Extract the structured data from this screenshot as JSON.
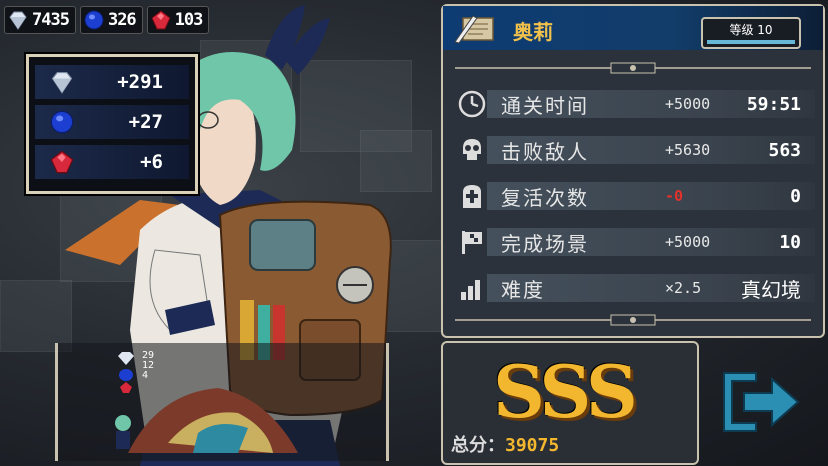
{
  "currency": {
    "diamond": {
      "icon": "diamond-icon",
      "value": "7435"
    },
    "sapphire": {
      "icon": "sapphire-icon",
      "value": "326"
    },
    "ruby": {
      "icon": "ruby-icon",
      "value": "103"
    }
  },
  "rewards": {
    "diamond": "+291",
    "sapphire": "+27",
    "ruby": "+6"
  },
  "character": {
    "name": "奥莉",
    "level_label": "等级 10",
    "level_progress": 1.0
  },
  "stats": [
    {
      "icon": "clock-icon",
      "label": "通关时间",
      "bonus": "+5000",
      "value": "59:51",
      "bonus_color": "#e8e8e8"
    },
    {
      "icon": "skull-icon",
      "label": "击败敌人",
      "bonus": "+5630",
      "value": "563",
      "bonus_color": "#e8e8e8"
    },
    {
      "icon": "tombstone-cross-icon",
      "label": "复活次数",
      "bonus": "-0",
      "value": "0",
      "bonus_color": "#e2322a"
    },
    {
      "icon": "flag-icon",
      "label": "完成场景",
      "bonus": "+5000",
      "value": "10",
      "bonus_color": "#e8e8e8"
    },
    {
      "icon": "difficulty-bars-icon",
      "label": "难度",
      "bonus": "×2.5",
      "value": "真幻境",
      "bonus_color": "#e8e8e8"
    }
  ],
  "score": {
    "rank": "SSS",
    "total_label": "总分：",
    "total_value": "39075"
  },
  "mini_scene": {
    "counts": [
      "29",
      "12",
      "4"
    ]
  },
  "colors": {
    "gold": "#f2b72e",
    "panel_border": "#c8c2ae",
    "header_blue": "#0d3b73",
    "next_arrow": "#2b8fb3"
  }
}
